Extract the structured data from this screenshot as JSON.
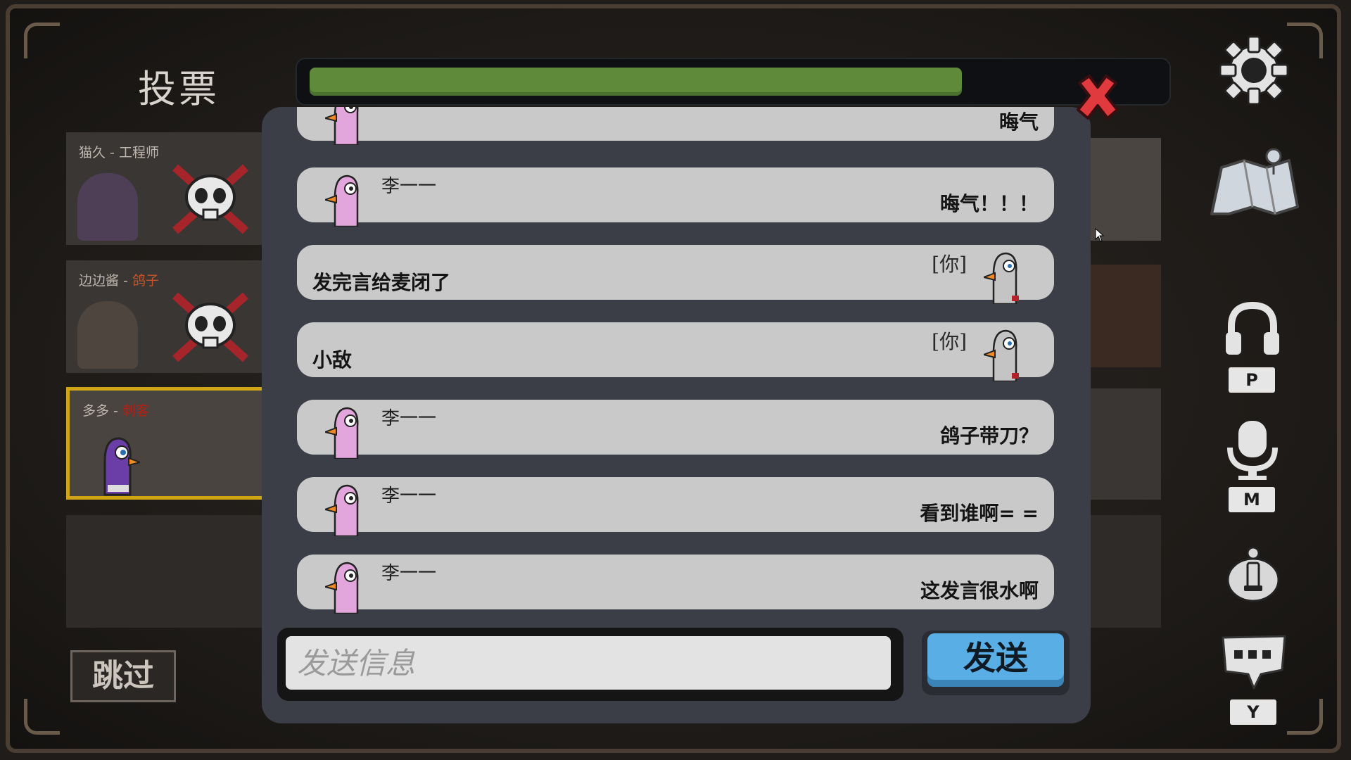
{
  "title": "投票",
  "timer": {
    "progress": 0.77,
    "color": "#5f8a3a"
  },
  "players": [
    {
      "name": "猫久",
      "sep": " - ",
      "role": "工程师",
      "dead": true
    },
    {
      "name": "边边酱",
      "sep": " - ",
      "role": "鸽子",
      "dead": true
    },
    {
      "name": "多多",
      "sep": " - ",
      "role": "刺客",
      "dead": false,
      "selected": true
    }
  ],
  "skip_label": "跳过",
  "chat": {
    "messages": [
      {
        "sender": "",
        "text": "晦气",
        "mine": false
      },
      {
        "sender": "李一一",
        "text": "晦气！！！",
        "mine": false
      },
      {
        "you_tag": "[你]",
        "text": "发完言给麦闭了",
        "mine": true
      },
      {
        "you_tag": "[你]",
        "text": "小敌",
        "mine": true
      },
      {
        "sender": "李一一",
        "text": "鸽子带刀？",
        "mine": false
      },
      {
        "sender": "李一一",
        "text": "看到谁啊= =",
        "mine": false
      },
      {
        "sender": "李一一",
        "text": "这发言很水啊",
        "mine": false
      }
    ],
    "input_placeholder": "发送信息",
    "send_label": "发送"
  },
  "side_icons": [
    {
      "icon": "gear-icon"
    },
    {
      "icon": "map-icon"
    },
    {
      "icon": "headphones-icon",
      "key": "P"
    },
    {
      "icon": "microphone-icon",
      "key": "M"
    },
    {
      "icon": "info-icon"
    },
    {
      "icon": "chat-icon",
      "key": "Y"
    }
  ],
  "colors": {
    "accent_green": "#5f8a3a",
    "send_blue": "#5aaee6",
    "close_red": "#e0393e",
    "selected_border": "#cfa417"
  }
}
